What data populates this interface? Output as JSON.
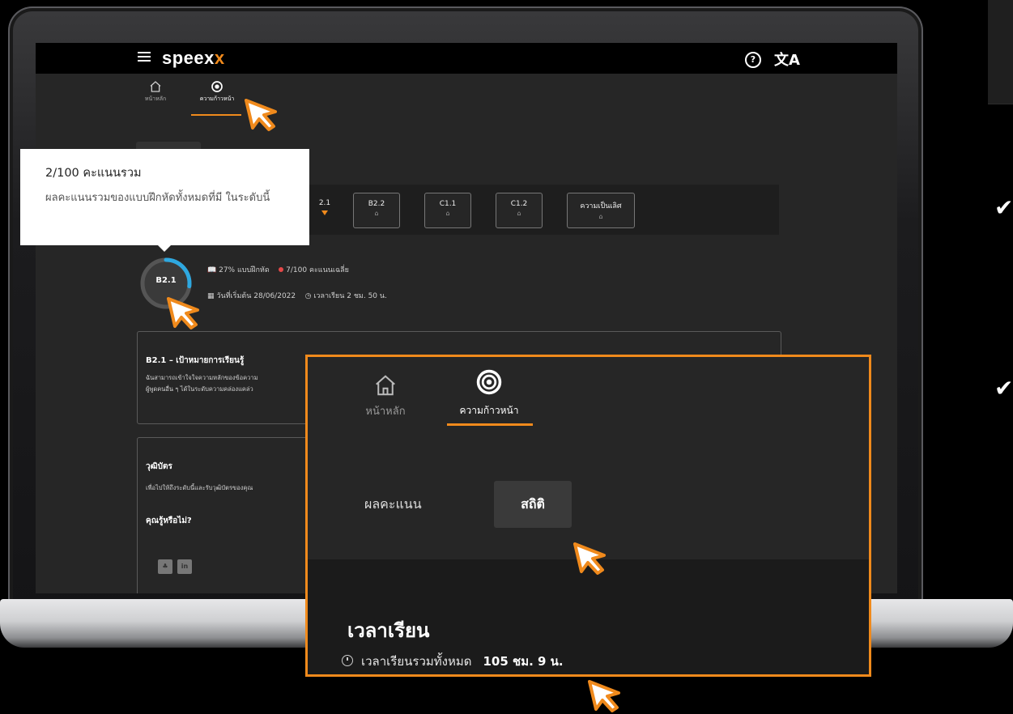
{
  "colors": {
    "accent": "#f08a1c",
    "background": "#262626",
    "bar": "#000000"
  },
  "app": {
    "logo_main": "speex",
    "logo_accent": "x",
    "help_icon": "?",
    "lang_icon": "文A"
  },
  "nav": {
    "home_label": "หน้าหลัก",
    "progress_label": "ความก้าวหน้า"
  },
  "tooltip": {
    "title": "2/100 คะแนนรวม",
    "description": "ผลคะแนนรวมของแบบฝึกหัดทั้งหมดที่มี ในระดับนี้"
  },
  "level_tabs": [
    {
      "label": "2.1",
      "locked": false,
      "current": true
    },
    {
      "label": "B2.2",
      "locked": true
    },
    {
      "label": "C1.1",
      "locked": true
    },
    {
      "label": "C1.2",
      "locked": true
    },
    {
      "label": "ความเป็นเลิศ",
      "locked": true
    }
  ],
  "progress_ring": {
    "label": "B2.1",
    "fraction": 0.27
  },
  "stats": {
    "exercises": "27% แบบฝึกหัด",
    "average": "7/100 คะแนนเฉลี่ย",
    "start_label": "วันที่เริ่มต้น",
    "start_date": "28/06/2022",
    "study_time_label": "เวลาเรียน",
    "study_time": "2 ชม. 50 น."
  },
  "goal_card": {
    "title": "B2.1 – เป้าหมายการเรียนรู้",
    "line1": "ฉันสามารถเข้าใจใจความหลักของข้อความ",
    "line2": "ผู้พูดคนอื่น ๆ ได้ในระดับความคล่องแคล่ว"
  },
  "cert_card": {
    "title": "วุฒิบัตร",
    "text": "เพื่อไปให้ถึงระดับนี้และรับวุฒิบัตรของคุณ",
    "did_you_know": "คุณรู้หรือไม่?",
    "social_1": "♣",
    "social_2": "in"
  },
  "zoom": {
    "home_label": "หน้าหลัก",
    "progress_label": "ความก้าวหน้า",
    "tab_score": "ผลคะแนน",
    "tab_stats": "สถิติ",
    "section_title": "เวลาเรียน",
    "total_label": "เวลาเรียนรวมทั้งหมด",
    "total_value": "105 ชม. 9 น."
  },
  "checks": [
    "✔",
    "✔"
  ]
}
